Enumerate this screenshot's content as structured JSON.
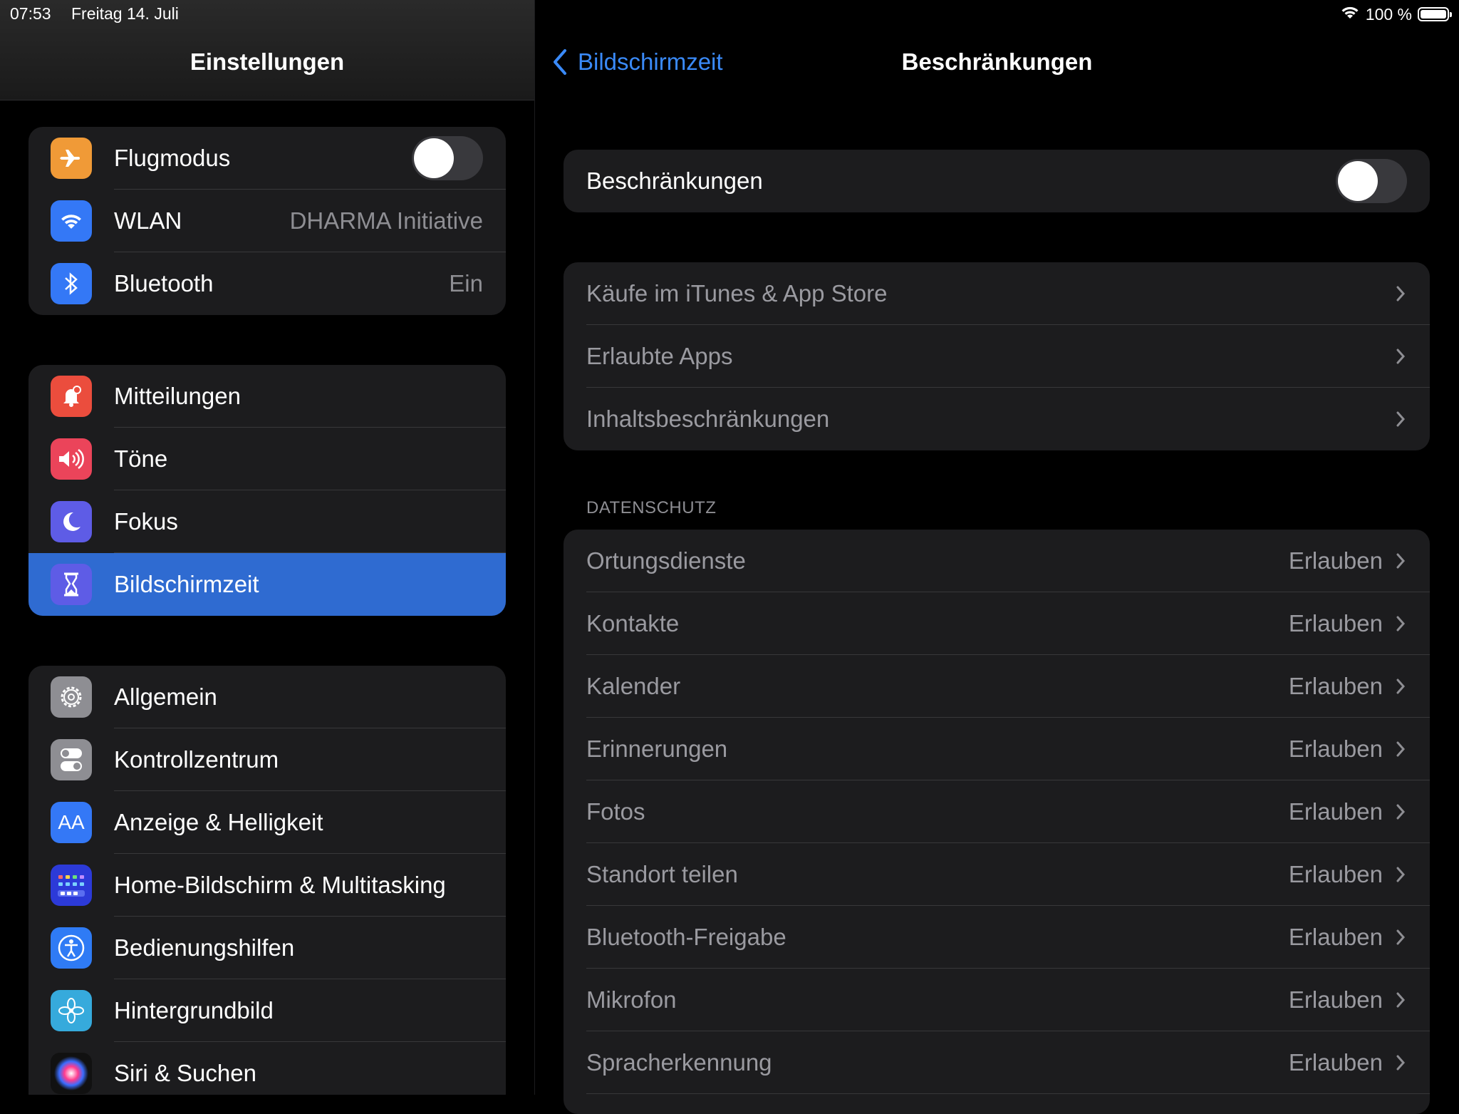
{
  "status_bar": {
    "time": "07:53",
    "date": "Freitag 14. Juli",
    "battery": "100 %"
  },
  "sidebar": {
    "title": "Einstellungen",
    "groups": [
      [
        {
          "label": "Flugmodus",
          "icon": "airplane-icon",
          "color": "#f09a37",
          "toggle": "off"
        },
        {
          "label": "WLAN",
          "icon": "wifi-icon",
          "color": "#3478f6",
          "value": "DHARMA Initiative"
        },
        {
          "label": "Bluetooth",
          "icon": "bluetooth-icon",
          "color": "#3478f6",
          "value": "Ein"
        }
      ],
      [
        {
          "label": "Mitteilungen",
          "icon": "notification-bell-icon",
          "color": "#eb4d3d"
        },
        {
          "label": "Töne",
          "icon": "speaker-icon",
          "color": "#eb445a"
        },
        {
          "label": "Fokus",
          "icon": "moon-icon",
          "color": "#5e5ce6"
        },
        {
          "label": "Bildschirmzeit",
          "icon": "hourglass-icon",
          "color": "#5e5ce6",
          "selected": true
        }
      ],
      [
        {
          "label": "Allgemein",
          "icon": "gear-icon",
          "color": "#8e8e93"
        },
        {
          "label": "Kontrollzentrum",
          "icon": "switches-icon",
          "color": "#8e8e93"
        },
        {
          "label": "Anzeige & Helligkeit",
          "icon": "text-size-icon",
          "color": "#3478f6"
        },
        {
          "label": "Home-Bildschirm & Multitasking",
          "icon": "home-grid-icon",
          "color": "#2c3ad8"
        },
        {
          "label": "Bedienungshilfen",
          "icon": "accessibility-icon",
          "color": "#2f7bf5"
        },
        {
          "label": "Hintergrundbild",
          "icon": "flower-icon",
          "color": "#36aadc"
        },
        {
          "label": "Siri & Suchen",
          "icon": "siri-icon",
          "color": "#222"
        }
      ]
    ]
  },
  "detail": {
    "back_label": "Bildschirmzeit",
    "title": "Beschränkungen",
    "master": {
      "label": "Beschränkungen",
      "toggle": "off"
    },
    "store_items": [
      {
        "label": "Käufe im iTunes & App Store"
      },
      {
        "label": "Erlaubte Apps"
      },
      {
        "label": "Inhaltsbeschränkungen"
      }
    ],
    "privacy_header": "DATENSCHUTZ",
    "privacy_items": [
      {
        "label": "Ortungsdienste",
        "value": "Erlauben"
      },
      {
        "label": "Kontakte",
        "value": "Erlauben"
      },
      {
        "label": "Kalender",
        "value": "Erlauben"
      },
      {
        "label": "Erinnerungen",
        "value": "Erlauben"
      },
      {
        "label": "Fotos",
        "value": "Erlauben"
      },
      {
        "label": "Standort teilen",
        "value": "Erlauben"
      },
      {
        "label": "Bluetooth-Freigabe",
        "value": "Erlauben"
      },
      {
        "label": "Mikrofon",
        "value": "Erlauben"
      },
      {
        "label": "Spracherkennung",
        "value": "Erlauben"
      }
    ]
  }
}
